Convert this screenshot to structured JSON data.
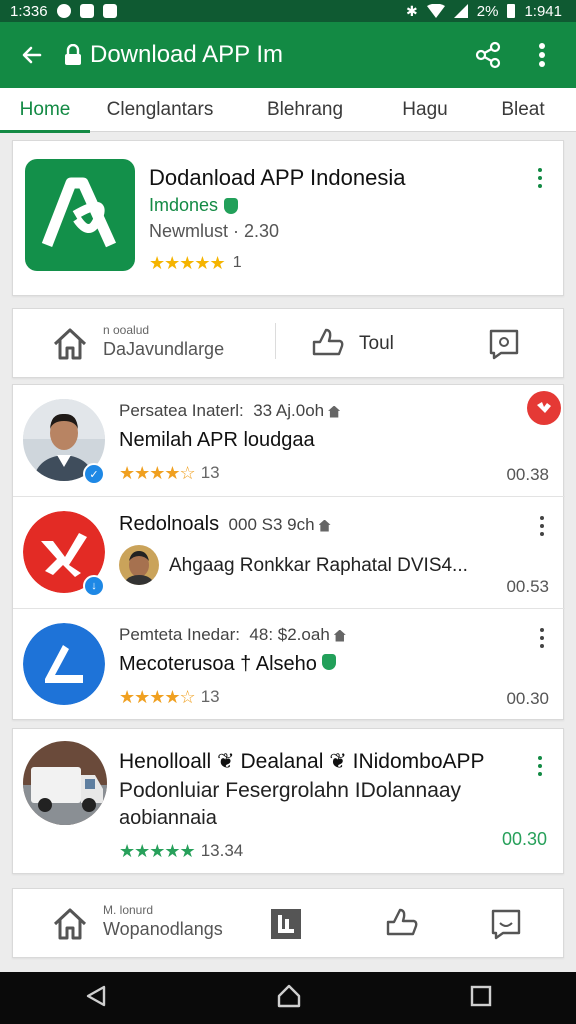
{
  "status_bar": {
    "time_left": "1:336",
    "battery": "2%",
    "time_right": "1:941"
  },
  "app_bar": {
    "title": "Download APP Im"
  },
  "tabs": [
    {
      "label": "Home",
      "active": true
    },
    {
      "label": "Clenglantars",
      "active": false
    },
    {
      "label": "Blehrang",
      "active": false
    },
    {
      "label": "Hagu",
      "active": false
    },
    {
      "label": "Bleat",
      "active": false
    }
  ],
  "main_app": {
    "name": "Dodanload APP Indonesia",
    "developer": "Imdones",
    "meta": "Newmlust · 2.30",
    "rating": "1",
    "stars": "★★★★★"
  },
  "action_bar_top": {
    "small_label": "n ooalud",
    "big_label": "DaJavundlarge",
    "middle_label": "Toul"
  },
  "list": [
    {
      "line1_prefix": "Persatea Inaterl:",
      "line1_suffix": "33 Aj.0oh",
      "line2": "Nemilah APR loudgaa",
      "stars": "★★★★☆",
      "rating": "13",
      "price": "00.38"
    },
    {
      "line1_prefix": "Redolnoals",
      "line1_suffix": "000 S3 9ch",
      "line2": "Ahgaag Ronkkar Raphatal  DVIS4...",
      "stars": "",
      "rating": "",
      "price": "00.53"
    },
    {
      "line1_prefix": "Pemteta Inedar:",
      "line1_suffix": "48: $2.oah",
      "line2": "Mecoterusoa † Alseho",
      "stars": "★★★★☆",
      "rating": "13",
      "price": "00.30"
    }
  ],
  "feature": {
    "line1": "Henolloall ❦ Dealanal ❦ INidomboAPP",
    "line2": "Podonluiar Fesergrolahn IDolannaay",
    "line3": "aobiannaia",
    "stars": "★★★★★",
    "rating": "13.34",
    "price": "00.30"
  },
  "action_bar_bottom": {
    "small_label": "M. lonurd",
    "big_label": "Wopanodlangs"
  },
  "colors": {
    "brand_green": "#138a44",
    "dark_green": "#0f5a32",
    "star_yellow": "#f5b400",
    "star_green": "#27a05a",
    "notification_red": "#e53935"
  }
}
